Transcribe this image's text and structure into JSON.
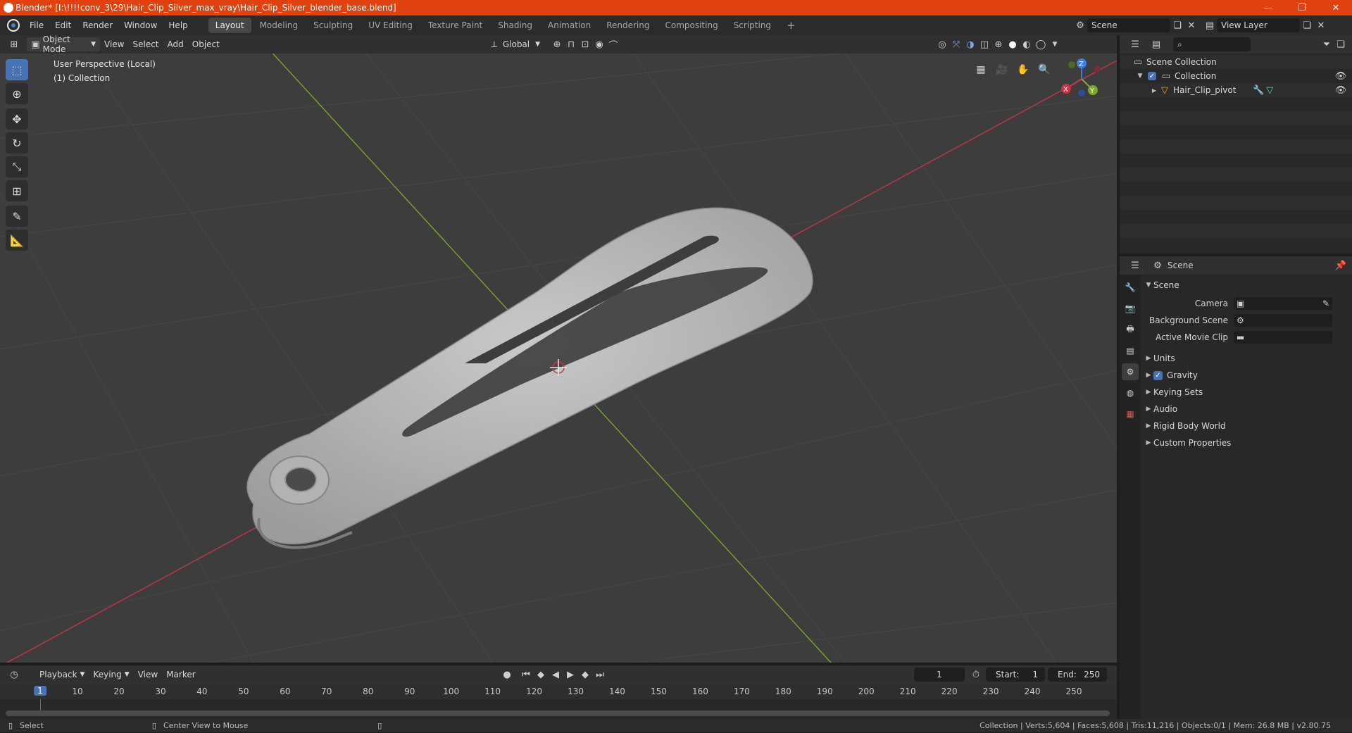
{
  "window": {
    "title": "Blender* [I:\\!!!!conv_3\\29\\Hair_Clip_Silver_max_vray\\Hair_Clip_Silver_blender_base.blend]",
    "minimize": "—",
    "maximize": "❐",
    "close": "✕"
  },
  "menu": {
    "items": [
      "File",
      "Edit",
      "Render",
      "Window",
      "Help"
    ],
    "workspaces": [
      "Layout",
      "Modeling",
      "Sculpting",
      "UV Editing",
      "Texture Paint",
      "Shading",
      "Animation",
      "Rendering",
      "Compositing",
      "Scripting"
    ],
    "active_workspace": "Layout",
    "add_workspace": "+",
    "scene_name": "Scene",
    "view_layer": "View Layer"
  },
  "viewport_header": {
    "mode": "Object Mode",
    "menus": [
      "View",
      "Select",
      "Add",
      "Object"
    ],
    "orientation": "Global"
  },
  "viewport": {
    "perspective": "User Perspective (Local)",
    "collection": "(1) Collection",
    "gizmo": {
      "x": "X",
      "y": "Y",
      "z": "Z"
    }
  },
  "timeline": {
    "menus": [
      "Playback",
      "Keying",
      "View",
      "Marker"
    ],
    "current_frame": "1",
    "start_label": "Start:",
    "start_value": "1",
    "end_label": "End:",
    "end_value": "250",
    "frame_numbers": [
      "1",
      "10",
      "20",
      "30",
      "40",
      "50",
      "60",
      "70",
      "80",
      "90",
      "100",
      "110",
      "120",
      "130",
      "140",
      "150",
      "160",
      "170",
      "180",
      "190",
      "200",
      "210",
      "220",
      "230",
      "240",
      "250"
    ]
  },
  "status": {
    "select": "Select",
    "center_view": "Center View to Mouse",
    "stats": "Collection | Verts:5,604 | Faces:5,608 | Tris:11,216 | Objects:0/1 | Mem: 26.8 MB | v2.80.75"
  },
  "outliner": {
    "scene_collection": "Scene Collection",
    "collection": "Collection",
    "object": "Hair_Clip_pivot"
  },
  "properties": {
    "header": "Scene",
    "panel": "Scene",
    "camera_label": "Camera",
    "background_scene_label": "Background Scene",
    "active_movie_clip_label": "Active Movie Clip",
    "subpanels": [
      "Units",
      "Gravity",
      "Keying Sets",
      "Audio",
      "Rigid Body World",
      "Custom Properties"
    ],
    "gravity_checked": true
  },
  "colors": {
    "titlebar": "#e0410f",
    "accent": "#4772b3",
    "x_axis": "#c8324a",
    "y_axis": "#7fa82a",
    "z_axis": "#3f7de0"
  }
}
